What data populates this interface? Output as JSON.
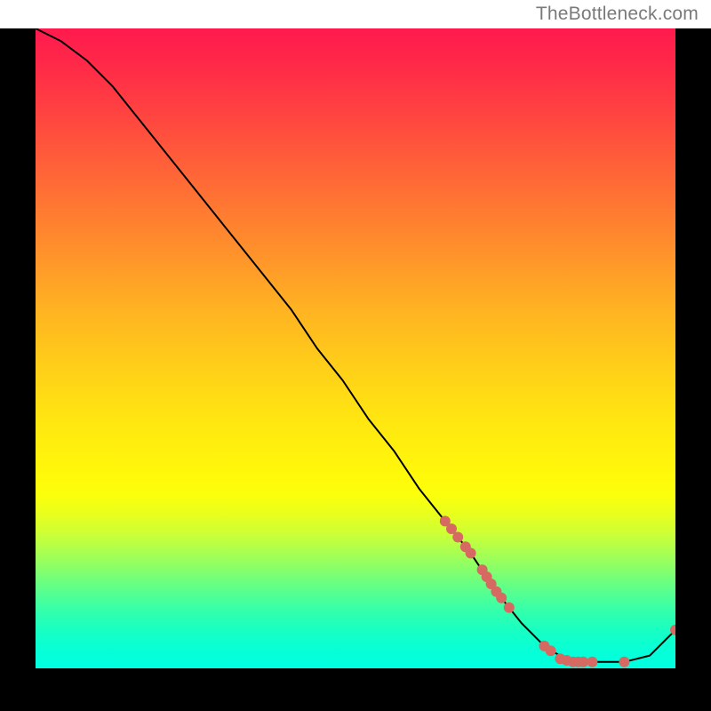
{
  "header": {
    "brand": "TheBottleneck.com"
  },
  "chart_data": {
    "type": "line",
    "title": "",
    "xlabel": "",
    "ylabel": "",
    "xlim": [
      0,
      100
    ],
    "ylim": [
      0,
      100
    ],
    "background_gradient": {
      "top": "#ff1a4e",
      "bottom": "#00ffe0"
    },
    "curve": {
      "color": "#000000",
      "x": [
        0,
        4,
        8,
        12,
        16,
        20,
        24,
        28,
        32,
        36,
        40,
        44,
        48,
        52,
        56,
        60,
        64,
        68,
        72,
        76,
        80,
        84,
        88,
        92,
        96,
        100
      ],
      "y": [
        100,
        98,
        95,
        91,
        86,
        81,
        76,
        71,
        66,
        61,
        56,
        50,
        45,
        39,
        34,
        28,
        23,
        18,
        12,
        7,
        3,
        1,
        1,
        1,
        2,
        6
      ]
    },
    "markers": {
      "color": "#d66a63",
      "radius": 6,
      "points": [
        {
          "x": 64.0,
          "y": 23.0
        },
        {
          "x": 65.0,
          "y": 21.8
        },
        {
          "x": 66.0,
          "y": 20.5
        },
        {
          "x": 67.2,
          "y": 19.0
        },
        {
          "x": 68.0,
          "y": 18.0
        },
        {
          "x": 69.8,
          "y": 15.4
        },
        {
          "x": 70.5,
          "y": 14.3
        },
        {
          "x": 71.2,
          "y": 13.2
        },
        {
          "x": 72.0,
          "y": 12.0
        },
        {
          "x": 72.8,
          "y": 11.0
        },
        {
          "x": 74.0,
          "y": 9.5
        },
        {
          "x": 79.5,
          "y": 3.5
        },
        {
          "x": 80.5,
          "y": 2.75
        },
        {
          "x": 82.0,
          "y": 1.5
        },
        {
          "x": 83.0,
          "y": 1.25
        },
        {
          "x": 84.0,
          "y": 1.0
        },
        {
          "x": 84.8,
          "y": 1.0
        },
        {
          "x": 85.6,
          "y": 1.0
        },
        {
          "x": 87.0,
          "y": 1.0
        },
        {
          "x": 92.0,
          "y": 1.0
        },
        {
          "x": 100.0,
          "y": 6.0
        }
      ]
    }
  }
}
